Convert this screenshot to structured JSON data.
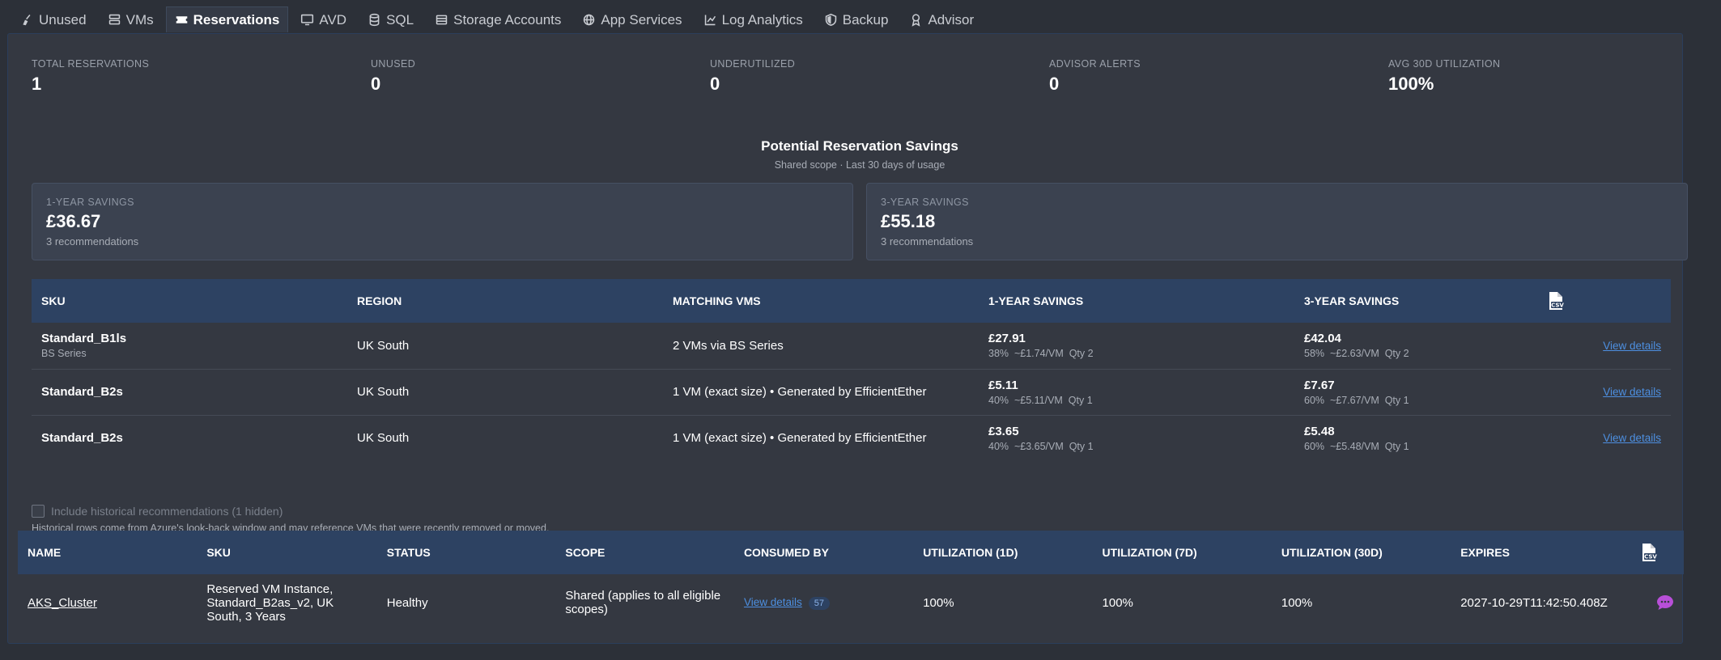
{
  "tabs": [
    {
      "label": "Unused",
      "icon": "broom-icon"
    },
    {
      "label": "VMs",
      "icon": "server-icon"
    },
    {
      "label": "Reservations",
      "icon": "ticket-icon",
      "active": true
    },
    {
      "label": "AVD",
      "icon": "monitor-icon"
    },
    {
      "label": "SQL",
      "icon": "database-icon"
    },
    {
      "label": "Storage Accounts",
      "icon": "storage-icon"
    },
    {
      "label": "App Services",
      "icon": "globe-icon"
    },
    {
      "label": "Log Analytics",
      "icon": "line-chart-icon"
    },
    {
      "label": "Backup",
      "icon": "shield-icon"
    },
    {
      "label": "Advisor",
      "icon": "award-icon"
    }
  ],
  "stats": [
    {
      "label": "TOTAL RESERVATIONS",
      "value": "1"
    },
    {
      "label": "UNUSED",
      "value": "0"
    },
    {
      "label": "UNDERUTILIZED",
      "value": "0"
    },
    {
      "label": "ADVISOR ALERTS",
      "value": "0"
    },
    {
      "label": "AVG 30D UTILIZATION",
      "value": "100%"
    }
  ],
  "savings": {
    "title": "Potential Reservation Savings",
    "subtitle": "Shared scope · Last 30 days of usage",
    "one_year": {
      "label": "1-YEAR SAVINGS",
      "amount": "£36.67",
      "count": "3 recommendations"
    },
    "three_year": {
      "label": "3-YEAR SAVINGS",
      "amount": "£55.18",
      "count": "3 recommendations"
    }
  },
  "recommendations": {
    "headers": [
      "SKU",
      "REGION",
      "MATCHING VMS",
      "1-YEAR SAVINGS",
      "3-YEAR SAVINGS"
    ],
    "rows": [
      {
        "sku": "Standard_B1ls",
        "series": "BS Series",
        "region": "UK South",
        "matching": "2 VMs via BS Series",
        "y1_amount": "£27.91",
        "y1_detail": "38%  ~£1.74/VM  Qty 2",
        "y3_amount": "£42.04",
        "y3_detail": "58%  ~£2.63/VM  Qty 2",
        "action": "View details"
      },
      {
        "sku": "Standard_B2s",
        "series": "",
        "region": "UK South",
        "matching": "1 VM (exact size) • Generated by EfficientEther",
        "y1_amount": "£5.11",
        "y1_detail": "40%  ~£5.11/VM  Qty 1",
        "y3_amount": "£7.67",
        "y3_detail": "60%  ~£7.67/VM  Qty 1",
        "action": "View details"
      },
      {
        "sku": "Standard_B2s",
        "series": "",
        "region": "UK South",
        "matching": "1 VM (exact size) • Generated by EfficientEther",
        "y1_amount": "£3.65",
        "y1_detail": "40%  ~£3.65/VM  Qty 1",
        "y3_amount": "£5.48",
        "y3_detail": "60%  ~£5.48/VM  Qty 1",
        "action": "View details"
      }
    ]
  },
  "historical": {
    "checkbox_label": "Include historical recommendations (1 hidden)",
    "note": "Historical rows come from Azure's look-back window and may reference VMs that were recently removed or moved."
  },
  "reservations": {
    "headers": [
      "NAME",
      "SKU",
      "STATUS",
      "SCOPE",
      "CONSUMED BY",
      "UTILIZATION (1D)",
      "UTILIZATION (7D)",
      "UTILIZATION (30D)",
      "EXPIRES"
    ],
    "rows": [
      {
        "name": "AKS_Cluster",
        "sku": "Reserved VM Instance, Standard_B2as_v2, UK South, 3 Years",
        "status": "Healthy",
        "scope": "Shared (applies to all eligible scopes)",
        "consumed_link": "View details",
        "consumed_count": "57",
        "u1": "100%",
        "u7": "100%",
        "u30": "100%",
        "expires": "2027-10-29T11:42:50.408Z"
      }
    ]
  },
  "colors": {
    "accent": "#2d4262",
    "link": "#4d8fe0",
    "healthy": "#5fc26a",
    "chat": "#b84fd8"
  }
}
